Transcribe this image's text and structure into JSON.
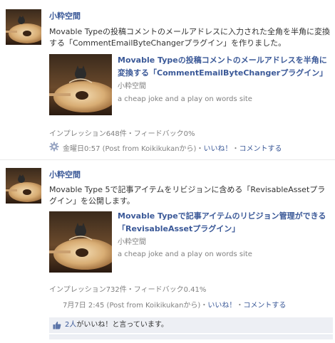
{
  "posts": [
    {
      "author": "小粋空間",
      "message": "Movable Typeの投稿コメントのメールアドレスに入力された全角を半角に変換する「CommentEmailByteChangerプラグイン」を作りました。",
      "attachment": {
        "title": "Movable Typeの投稿コメントのメールアドレスを半角に変換する「CommentEmailByteChangerプラグイン」",
        "site": "小粋空間",
        "description": "a cheap joke and a play on words site"
      },
      "stats": "インプレッション648件・フィードバック0%",
      "timestamp": "金曜日0:57",
      "source": "(Post from Koikikukanから)",
      "like_link": "いいね！",
      "comment_link": "コメントする"
    },
    {
      "author": "小粋空間",
      "message": "Movable Type 5で記事アイテムをリビジョンに含める「RevisableAssetプラグイン」を公開します。",
      "attachment": {
        "title": "Movable Typeで記事アイテムのリビジョン管理ができる「RevisableAssetプラグイン」",
        "site": "小粋空間",
        "description": "a cheap joke and a play on words site"
      },
      "stats": "インプレッション732件・フィードバック0.41%",
      "timestamp": "7月7日 2:45",
      "source": "(Post from Koikikukanから)",
      "like_link": "いいね！",
      "comment_link": "コメントする",
      "likes": {
        "count_text": "2人",
        "suffix": "がいいね！と言っています。"
      }
    }
  ],
  "colors": {
    "link": "#3b5998",
    "muted": "#808080",
    "like_bar_bg": "#edeff4"
  },
  "icons": {
    "post_gear": "gear-icon",
    "likes": "thumbs-up-icon"
  }
}
